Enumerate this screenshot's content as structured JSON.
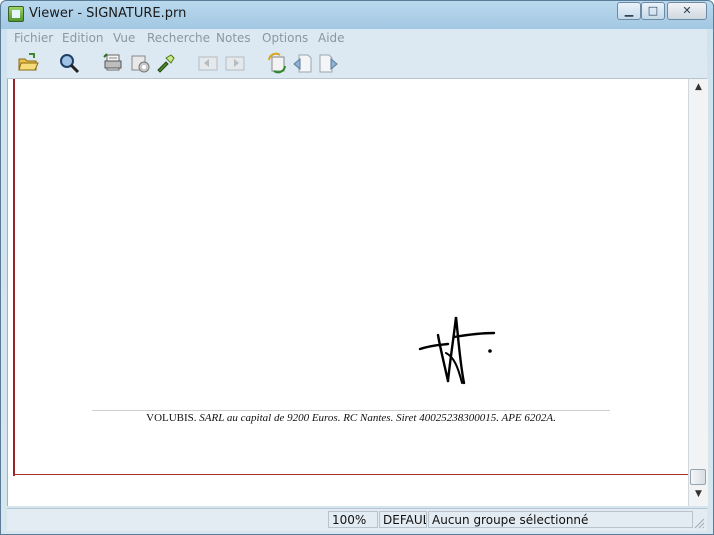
{
  "window": {
    "title": "Viewer - SIGNATURE.prn",
    "minimize_glyph": "▁",
    "maximize_glyph": "□",
    "close_glyph": "✕"
  },
  "menu": {
    "items": [
      {
        "label": "Fichier"
      },
      {
        "label": "Edition"
      },
      {
        "label": "Vue"
      },
      {
        "label": "Recherche"
      },
      {
        "label": "Notes"
      },
      {
        "label": "Options"
      },
      {
        "label": "Aide"
      }
    ]
  },
  "toolbar": {
    "icons": [
      "open-folder-icon",
      "zoom-search-icon",
      "print-pages-icon",
      "print-settings-icon",
      "flashlight-icon",
      "previous-page-icon",
      "next-page-icon",
      "refresh-icon",
      "page-back-icon",
      "page-forward-icon"
    ]
  },
  "document": {
    "footer_roman": "VOLUBIS. ",
    "footer_italic": "SARL au capital de 9200 Euros. RC Nantes. Siret 40025238300015. APE 6202A."
  },
  "scrollbar": {
    "up_glyph": "▲",
    "down_glyph": "▼"
  },
  "status": {
    "zoom": "100%",
    "group_code": "DEFAUL'",
    "group_message": "Aucun groupe sélectionné"
  },
  "colors": {
    "page_border": "#9a2424",
    "menu_text_disabled": "#8a96a2"
  }
}
